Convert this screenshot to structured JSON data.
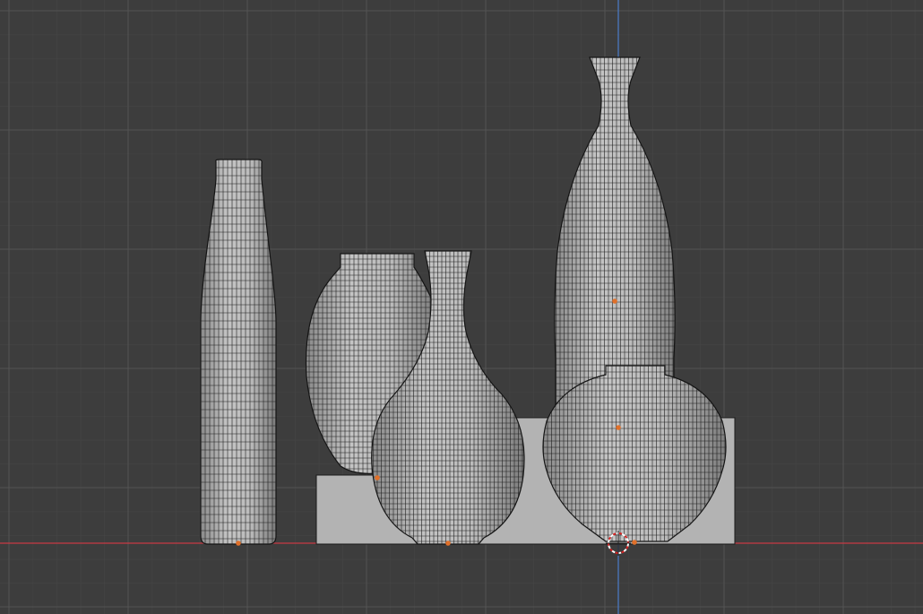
{
  "viewport": {
    "background": "#3d3d3d",
    "grid_minor_color": "#464646",
    "grid_major_color": "#535353",
    "x_axis_color": "#c83a44",
    "z_axis_color": "#4a78c0"
  },
  "objects": [
    {
      "name": "tall-bottle"
    },
    {
      "name": "round-vase"
    },
    {
      "name": "pear-vase"
    },
    {
      "name": "long-neck-vase"
    },
    {
      "name": "squat-pot"
    },
    {
      "name": "pedestal-box"
    }
  ],
  "icons": {
    "origin": "origin-dot-icon",
    "cursor": "3d-cursor-icon"
  },
  "colors": {
    "mesh_fill": "#aeaeae",
    "wire": "#141414",
    "box_fill": "#b3b3b3",
    "origin": "#e0702a"
  }
}
